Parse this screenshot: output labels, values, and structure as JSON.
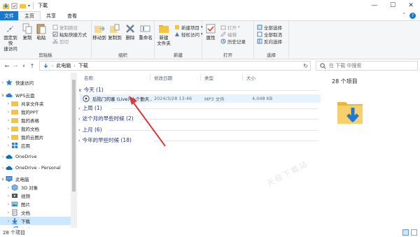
{
  "window": {
    "title": "下載"
  },
  "ribbon_tabs": [
    {
      "label": "文件"
    },
    {
      "label": "主页"
    },
    {
      "label": "共享"
    },
    {
      "label": "查看"
    }
  ],
  "ribbon": {
    "clipboard": {
      "group_label": "剪贴板",
      "pin_label": "固定到快\n速访问",
      "copy_label": "复制",
      "paste_label": "粘贴",
      "copy_path_label": "复制路径",
      "paste_shortcut_label": "粘贴快捷方式",
      "cut_label": "剪切"
    },
    "organize": {
      "group_label": "组织",
      "move_to_label": "移动到",
      "copy_to_label": "复制到",
      "delete_label": "删除",
      "rename_label": "重命名"
    },
    "new": {
      "group_label": "新建",
      "new_folder_label": "新建\n文件夹",
      "new_item_label": "新建项目",
      "easy_access_label": "轻松访问"
    },
    "open": {
      "group_label": "打开",
      "properties_label": "属性",
      "open_label": "打开",
      "edit_label": "编辑",
      "history_label": "历史记录"
    },
    "select": {
      "group_label": "选择",
      "select_all_label": "全部选择",
      "select_none_label": "全部取消",
      "invert_label": "反向选择"
    }
  },
  "address": {
    "crumbs": [
      "此电脑",
      "下载"
    ],
    "search_placeholder": "在 下载 中搜索"
  },
  "sidebar": {
    "items": [
      {
        "label": "快速访问"
      },
      {
        "label": "WPS云盘"
      },
      {
        "label": "共享文件夹"
      },
      {
        "label": "我的PPT"
      },
      {
        "label": "我的表格"
      },
      {
        "label": "我的文档"
      },
      {
        "label": "我的云图片"
      },
      {
        "label": "应用"
      },
      {
        "label": "OneDrive"
      },
      {
        "label": "OneDrive - Personal"
      },
      {
        "label": "此电脑"
      },
      {
        "label": "3D 对象"
      },
      {
        "label": "视频"
      },
      {
        "label": "图片"
      },
      {
        "label": "文档"
      },
      {
        "label": "下载"
      },
      {
        "label": "音乐"
      }
    ]
  },
  "list": {
    "columns": [
      "名称",
      "修改日期",
      "类型",
      "大小"
    ],
    "groups": [
      {
        "label": "今天 (1)"
      },
      {
        "label": "上周 (1)"
      },
      {
        "label": "这个月的早些时候 (2)"
      },
      {
        "label": "上月 (6)"
      },
      {
        "label": "今年的早些时候 (18)"
      }
    ],
    "files": [
      {
        "name": "后陆门的塞 (Live)-十个勤天...",
        "date": "2024/3/28 13:46",
        "type": "MP3 文件",
        "size": "4,048 KB"
      }
    ]
  },
  "preview": {
    "count": "28 个项目"
  },
  "status": {
    "count": "28 个项目"
  },
  "watermark": "天极下载站",
  "colors": {
    "accent": "#1979ca",
    "group_text": "#1e3287",
    "arrow": "#d93a3a",
    "selection": "#cce8ff"
  }
}
